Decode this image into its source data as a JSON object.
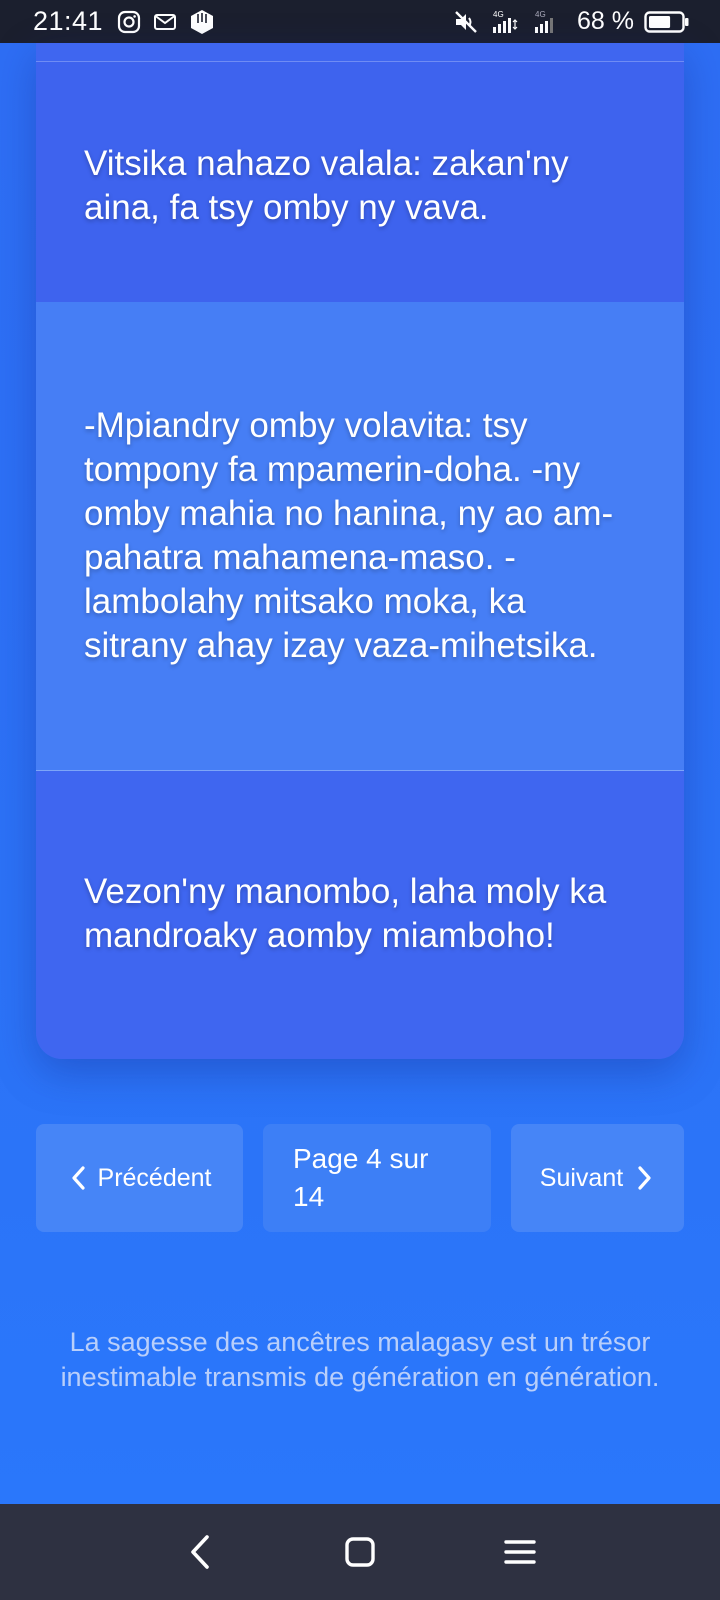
{
  "status_bar": {
    "time": "21:41",
    "battery_percent": "68 %",
    "battery_level": 0.68,
    "network_labels": [
      "4G",
      "4G"
    ],
    "icons": [
      "instagram-icon",
      "mail-icon",
      "app-shield-icon",
      "mute-icon",
      "signal-icon",
      "signal-icon",
      "battery-icon"
    ]
  },
  "proverbs": [
    "Vitsika nahazo valala: zakan'ny aina, fa tsy omby ny vava.",
    "-Mpiandry omby volavita: tsy tompony fa mpamerin-doha. -ny omby mahia no hanina, ny ao am-pahatra mahamena-maso. -lambolahy mitsako moka, ka sitrany ahay izay vaza-mihetsika.",
    "Vezon'ny manombo, laha moly ka mandroaky aomby miamboho!"
  ],
  "pagination": {
    "prev_label": "Précédent",
    "page_info": "Page 4 sur 14",
    "next_label": "Suivant"
  },
  "footer": {
    "text": "La sagesse des ancêtres malagasy est un trésor inestimable transmis de génération en génération."
  },
  "nav_bar": {
    "buttons": [
      "back-icon",
      "home-icon",
      "menu-icon"
    ]
  },
  "colors": {
    "background": "#2b72f5",
    "card_dark": "#3e63ee",
    "card_light": "#467ef5",
    "status_bar": "#1b1f2e",
    "nav_bar": "#2e3141"
  }
}
